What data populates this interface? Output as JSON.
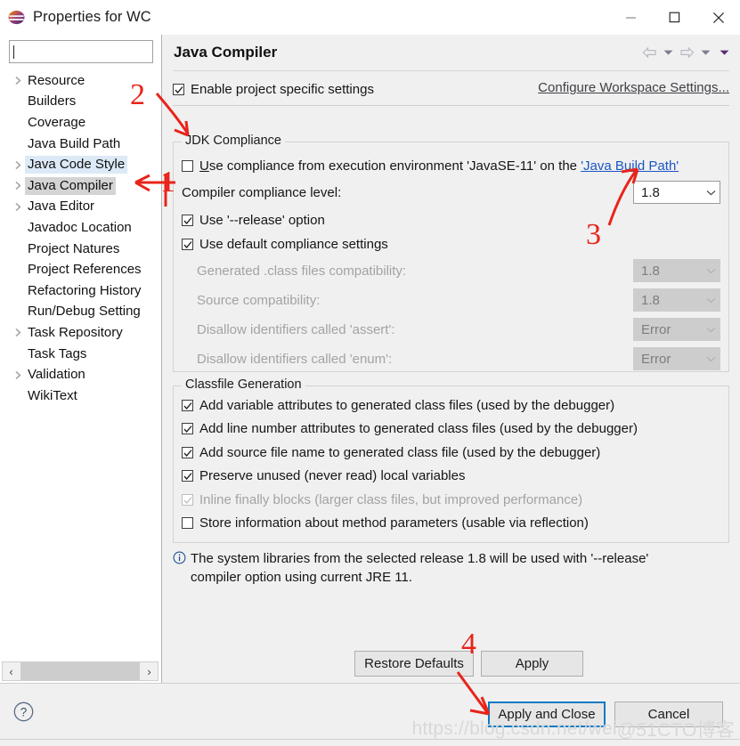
{
  "window": {
    "title": "Properties for WC",
    "icon": "eclipse-sphere-icon",
    "minimize_label": "Minimize",
    "maximize_label": "Maximize",
    "close_label": "Close"
  },
  "sidebar": {
    "search": {
      "value": "",
      "placeholder": ""
    },
    "items": [
      {
        "label": "Resource",
        "expandable": true,
        "state": "normal"
      },
      {
        "label": "Builders",
        "expandable": false,
        "state": "normal"
      },
      {
        "label": "Coverage",
        "expandable": false,
        "state": "normal"
      },
      {
        "label": "Java Build Path",
        "expandable": false,
        "state": "normal"
      },
      {
        "label": "Java Code Style",
        "expandable": true,
        "state": "previous"
      },
      {
        "label": "Java Compiler",
        "expandable": true,
        "state": "selected"
      },
      {
        "label": "Java Editor",
        "expandable": true,
        "state": "normal"
      },
      {
        "label": "Javadoc Location",
        "expandable": false,
        "state": "normal"
      },
      {
        "label": "Project Natures",
        "expandable": false,
        "state": "normal"
      },
      {
        "label": "Project References",
        "expandable": false,
        "state": "normal"
      },
      {
        "label": "Refactoring History",
        "expandable": false,
        "state": "normal"
      },
      {
        "label": "Run/Debug Setting",
        "expandable": false,
        "state": "normal"
      },
      {
        "label": "Task Repository",
        "expandable": true,
        "state": "normal"
      },
      {
        "label": "Task Tags",
        "expandable": false,
        "state": "normal"
      },
      {
        "label": "Validation",
        "expandable": true,
        "state": "normal"
      },
      {
        "label": "WikiText",
        "expandable": false,
        "state": "normal"
      }
    ],
    "scrollbar": {
      "left_arrow": "‹",
      "right_arrow": "›"
    }
  },
  "page": {
    "title": "Java Compiler",
    "nav": {
      "back": "back-arrow",
      "back_menu": "back-dropdown",
      "forward": "forward-arrow",
      "forward_menu": "forward-dropdown",
      "view_menu": "view-menu"
    },
    "enable_project_specific": {
      "label": "Enable project specific settings",
      "checked": true,
      "enabled": true
    },
    "configure_workspace_link": "Configure Workspace Settings...",
    "jdk_compliance": {
      "title": "JDK Compliance",
      "use_execution_env": {
        "label_before": "Use compliance from execution environment 'JavaSE-11' on the ",
        "link": "'Java Build Path'",
        "checked": false,
        "mnemonic": "U"
      },
      "compliance_level": {
        "label": "Compiler compliance level:",
        "value": "1.8",
        "enabled": true
      },
      "use_release_option": {
        "label": "Use '--release' option",
        "checked": true,
        "enabled": true
      },
      "use_default_settings": {
        "label": "Use default compliance settings",
        "checked": true,
        "enabled": true
      },
      "rows": [
        {
          "label": "Generated .class files compatibility:",
          "value": "1.8",
          "enabled": false
        },
        {
          "label": "Source compatibility:",
          "value": "1.8",
          "enabled": false
        },
        {
          "label": "Disallow identifiers called 'assert':",
          "value": "Error",
          "enabled": false
        },
        {
          "label": "Disallow identifiers called 'enum':",
          "value": "Error",
          "enabled": false
        }
      ]
    },
    "classfile_generation": {
      "title": "Classfile Generation",
      "options": [
        {
          "label": "Add variable attributes to generated class files (used by the debugger)",
          "checked": true,
          "enabled": true
        },
        {
          "label": "Add line number attributes to generated class files (used by the debugger)",
          "checked": true,
          "enabled": true
        },
        {
          "label": "Add source file name to generated class file (used by the debugger)",
          "checked": true,
          "enabled": true
        },
        {
          "label": "Preserve unused (never read) local variables",
          "checked": true,
          "enabled": true
        },
        {
          "label": "Inline finally blocks (larger class files, but improved performance)",
          "checked": true,
          "enabled": false
        },
        {
          "label": "Store information about method parameters (usable via reflection)",
          "checked": false,
          "enabled": true
        }
      ]
    },
    "info_message": {
      "icon": "info-icon",
      "line1": "The system libraries from the selected release 1.8 will be used with '--release'",
      "line2": "compiler option using current JRE 11."
    }
  },
  "buttons": {
    "restore_defaults": "Restore Defaults",
    "apply": "Apply",
    "apply_and_close": "Apply and Close",
    "cancel": "Cancel",
    "help": "help-icon"
  },
  "annotations": [
    {
      "number": "1",
      "target": "sidebar-item-java-compiler"
    },
    {
      "number": "2",
      "target": "use-execution-env-checkbox"
    },
    {
      "number": "3",
      "target": "compliance-level-combo"
    },
    {
      "number": "4",
      "target": "apply-and-close-button"
    }
  ],
  "watermark": {
    "url": "https://blog.csdn.net/wei",
    "site": "@51CTO博客"
  },
  "colors": {
    "accent": "#0d7ac4",
    "link": "#1a56c4",
    "annotation": "#e8241b",
    "panel": "#f0f0f0",
    "selected": "#d4d4d4",
    "previous": "#dce9f7"
  }
}
